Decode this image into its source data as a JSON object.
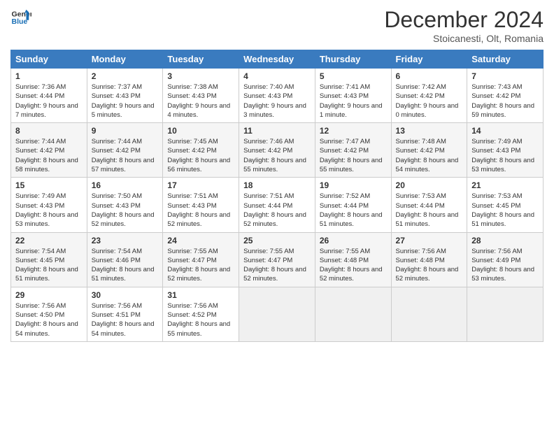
{
  "header": {
    "logo_line1": "General",
    "logo_line2": "Blue",
    "month": "December 2024",
    "location": "Stoicanesti, Olt, Romania"
  },
  "days_of_week": [
    "Sunday",
    "Monday",
    "Tuesday",
    "Wednesday",
    "Thursday",
    "Friday",
    "Saturday"
  ],
  "weeks": [
    [
      {
        "day": "1",
        "info": "Sunrise: 7:36 AM\nSunset: 4:44 PM\nDaylight: 9 hours and 7 minutes."
      },
      {
        "day": "2",
        "info": "Sunrise: 7:37 AM\nSunset: 4:43 PM\nDaylight: 9 hours and 5 minutes."
      },
      {
        "day": "3",
        "info": "Sunrise: 7:38 AM\nSunset: 4:43 PM\nDaylight: 9 hours and 4 minutes."
      },
      {
        "day": "4",
        "info": "Sunrise: 7:40 AM\nSunset: 4:43 PM\nDaylight: 9 hours and 3 minutes."
      },
      {
        "day": "5",
        "info": "Sunrise: 7:41 AM\nSunset: 4:43 PM\nDaylight: 9 hours and 1 minute."
      },
      {
        "day": "6",
        "info": "Sunrise: 7:42 AM\nSunset: 4:42 PM\nDaylight: 9 hours and 0 minutes."
      },
      {
        "day": "7",
        "info": "Sunrise: 7:43 AM\nSunset: 4:42 PM\nDaylight: 8 hours and 59 minutes."
      }
    ],
    [
      {
        "day": "8",
        "info": "Sunrise: 7:44 AM\nSunset: 4:42 PM\nDaylight: 8 hours and 58 minutes."
      },
      {
        "day": "9",
        "info": "Sunrise: 7:44 AM\nSunset: 4:42 PM\nDaylight: 8 hours and 57 minutes."
      },
      {
        "day": "10",
        "info": "Sunrise: 7:45 AM\nSunset: 4:42 PM\nDaylight: 8 hours and 56 minutes."
      },
      {
        "day": "11",
        "info": "Sunrise: 7:46 AM\nSunset: 4:42 PM\nDaylight: 8 hours and 55 minutes."
      },
      {
        "day": "12",
        "info": "Sunrise: 7:47 AM\nSunset: 4:42 PM\nDaylight: 8 hours and 55 minutes."
      },
      {
        "day": "13",
        "info": "Sunrise: 7:48 AM\nSunset: 4:42 PM\nDaylight: 8 hours and 54 minutes."
      },
      {
        "day": "14",
        "info": "Sunrise: 7:49 AM\nSunset: 4:43 PM\nDaylight: 8 hours and 53 minutes."
      }
    ],
    [
      {
        "day": "15",
        "info": "Sunrise: 7:49 AM\nSunset: 4:43 PM\nDaylight: 8 hours and 53 minutes."
      },
      {
        "day": "16",
        "info": "Sunrise: 7:50 AM\nSunset: 4:43 PM\nDaylight: 8 hours and 52 minutes."
      },
      {
        "day": "17",
        "info": "Sunrise: 7:51 AM\nSunset: 4:43 PM\nDaylight: 8 hours and 52 minutes."
      },
      {
        "day": "18",
        "info": "Sunrise: 7:51 AM\nSunset: 4:44 PM\nDaylight: 8 hours and 52 minutes."
      },
      {
        "day": "19",
        "info": "Sunrise: 7:52 AM\nSunset: 4:44 PM\nDaylight: 8 hours and 51 minutes."
      },
      {
        "day": "20",
        "info": "Sunrise: 7:53 AM\nSunset: 4:44 PM\nDaylight: 8 hours and 51 minutes."
      },
      {
        "day": "21",
        "info": "Sunrise: 7:53 AM\nSunset: 4:45 PM\nDaylight: 8 hours and 51 minutes."
      }
    ],
    [
      {
        "day": "22",
        "info": "Sunrise: 7:54 AM\nSunset: 4:45 PM\nDaylight: 8 hours and 51 minutes."
      },
      {
        "day": "23",
        "info": "Sunrise: 7:54 AM\nSunset: 4:46 PM\nDaylight: 8 hours and 51 minutes."
      },
      {
        "day": "24",
        "info": "Sunrise: 7:55 AM\nSunset: 4:47 PM\nDaylight: 8 hours and 52 minutes."
      },
      {
        "day": "25",
        "info": "Sunrise: 7:55 AM\nSunset: 4:47 PM\nDaylight: 8 hours and 52 minutes."
      },
      {
        "day": "26",
        "info": "Sunrise: 7:55 AM\nSunset: 4:48 PM\nDaylight: 8 hours and 52 minutes."
      },
      {
        "day": "27",
        "info": "Sunrise: 7:56 AM\nSunset: 4:48 PM\nDaylight: 8 hours and 52 minutes."
      },
      {
        "day": "28",
        "info": "Sunrise: 7:56 AM\nSunset: 4:49 PM\nDaylight: 8 hours and 53 minutes."
      }
    ],
    [
      {
        "day": "29",
        "info": "Sunrise: 7:56 AM\nSunset: 4:50 PM\nDaylight: 8 hours and 54 minutes."
      },
      {
        "day": "30",
        "info": "Sunrise: 7:56 AM\nSunset: 4:51 PM\nDaylight: 8 hours and 54 minutes."
      },
      {
        "day": "31",
        "info": "Sunrise: 7:56 AM\nSunset: 4:52 PM\nDaylight: 8 hours and 55 minutes."
      },
      null,
      null,
      null,
      null
    ]
  ]
}
